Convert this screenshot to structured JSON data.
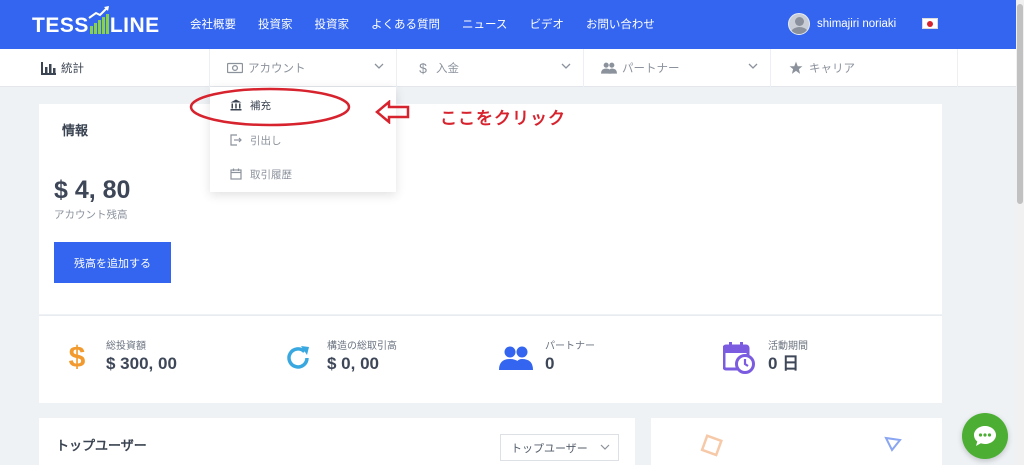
{
  "header": {
    "logo_left": "TESS",
    "logo_right": "LINE",
    "nav": [
      "会社概要",
      "投資家",
      "投資家",
      "よくある質問",
      "ニュース",
      "ビデオ",
      "お問い合わせ"
    ],
    "username": "shimajiri noriaki"
  },
  "subnav": {
    "stats": "統計",
    "account": "アカウント",
    "deposit": "入金",
    "partner": "パートナー",
    "career": "キャリア"
  },
  "dropdown": {
    "items": [
      "補充",
      "引出し",
      "取引履歴"
    ]
  },
  "annotation": {
    "text": "ここをクリック",
    "color": "#d7232e"
  },
  "info": {
    "title": "情報",
    "balance": "$ 4, 80",
    "balance_label": "アカウント残高",
    "add_button": "残高を追加する"
  },
  "stats": [
    {
      "label": "総投資額",
      "value": "$ 300, 00",
      "icon": "dollar-icon",
      "color": "#f29a2e"
    },
    {
      "label": "構造の総取引高",
      "value": "$ 0, 00",
      "icon": "refresh-icon",
      "color": "#39a8e0"
    },
    {
      "label": "パートナー",
      "value": "0",
      "icon": "users-icon",
      "color": "#3365f0"
    },
    {
      "label": "活動期間",
      "value": "0 日",
      "icon": "calendar-clock-icon",
      "color": "#7b5ce0"
    }
  ],
  "top_users": {
    "title": "トップユーザー",
    "select_value": "トップユーザー"
  },
  "colors": {
    "primary": "#3365f0",
    "logo_accent": "#8ad14a",
    "chat": "#4caf33"
  }
}
